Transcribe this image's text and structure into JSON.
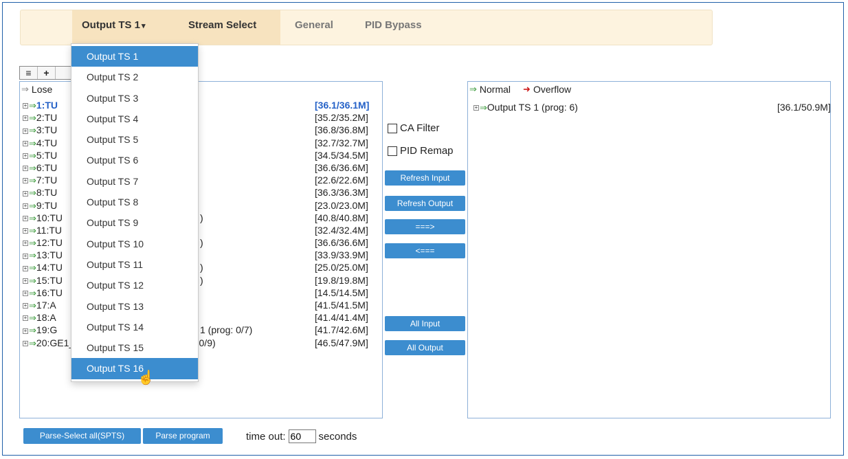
{
  "tabs": {
    "dropdown_label": "Output TS 1",
    "caret": "▾",
    "stream_select": "Stream Select",
    "general": "General",
    "pid_bypass": "PID Bypass"
  },
  "toolbar": {
    "list_icon": "≡",
    "add_icon": "+"
  },
  "left_panel": {
    "legend_lose": "Lose",
    "rows": [
      {
        "name": "1:TU",
        "rate": "[36.1/36.1M]"
      },
      {
        "name": "2:TU",
        "rate": "[35.2/35.2M]"
      },
      {
        "name": "3:TU",
        "rate": "[36.8/36.8M]"
      },
      {
        "name": "4:TU",
        "rate": "[32.7/32.7M]"
      },
      {
        "name": "5:TU",
        "rate": "[34.5/34.5M]"
      },
      {
        "name": "6:TU",
        "rate": "[36.6/36.6M]"
      },
      {
        "name": "7:TU",
        "rate": "[22.6/22.6M]"
      },
      {
        "name": "8:TU",
        "rate": "[36.3/36.3M]"
      },
      {
        "name": "9:TU",
        "rate": "[23.0/23.0M]"
      },
      {
        "name": "10:TU",
        "rate": "[40.8/40.8M]"
      },
      {
        "name": "11:TU",
        "rate": "[32.4/32.4M]"
      },
      {
        "name": "12:TU",
        "rate": "[36.6/36.6M]"
      },
      {
        "name": "13:TU",
        "rate": "[33.9/33.9M]"
      },
      {
        "name": "14:TU",
        "rate": "[25.0/25.0M]"
      },
      {
        "name": "15:TU",
        "rate": "[19.8/19.8M]"
      },
      {
        "name": "16:TU",
        "rate": "[14.5/14.5M]"
      },
      {
        "name": "17:A",
        "rate": "[41.5/41.5M]"
      },
      {
        "name": "18:A",
        "rate": "[41.4/41.4M]"
      },
      {
        "name": "19:G",
        "rate": "[41.7/42.6M]"
      },
      {
        "name": "20:GE1_CH2_224.2.2.2:10002 (prog: 0/9)",
        "rate": "[46.5/47.9M]"
      }
    ],
    "partial_suffixes": {
      "r10": ")",
      "r12": ")",
      "r14": ")",
      "r15": ")",
      "r19": "1 (prog: 0/7)"
    }
  },
  "middle": {
    "ca_filter": "CA Filter",
    "pid_remap": "PID Remap",
    "refresh_input": "Refresh Input",
    "refresh_output": "Refresh Output",
    "add_arrow": "===>",
    "remove_arrow": "<===",
    "all_input": "All Input",
    "all_output": "All Output"
  },
  "right_panel": {
    "legend_normal": "Normal",
    "legend_overflow": "Overflow",
    "rows": [
      {
        "name": "Output TS 1 (prog: 6)",
        "rate": "[36.1/50.9M]"
      }
    ]
  },
  "bottom": {
    "parse_select_all": "Parse-Select all(SPTS)",
    "parse_program": "Parse program",
    "timeout_label": "time out:",
    "timeout_value": "60",
    "seconds": "seconds"
  },
  "dropdown": {
    "selected": "Output TS 16",
    "items": [
      "Output TS 1",
      "Output TS 2",
      "Output TS 3",
      "Output TS 4",
      "Output TS 5",
      "Output TS 6",
      "Output TS 7",
      "Output TS 8",
      "Output TS 9",
      "Output TS 10",
      "Output TS 11",
      "Output TS 12",
      "Output TS 13",
      "Output TS 14",
      "Output TS 15",
      "Output TS 16"
    ]
  },
  "colors": {
    "accent": "#3c8dcf",
    "tab_bg": "#fdf3df",
    "normal_arrow": "#3a9a3a",
    "overflow_arrow": "#cc1a1a"
  }
}
